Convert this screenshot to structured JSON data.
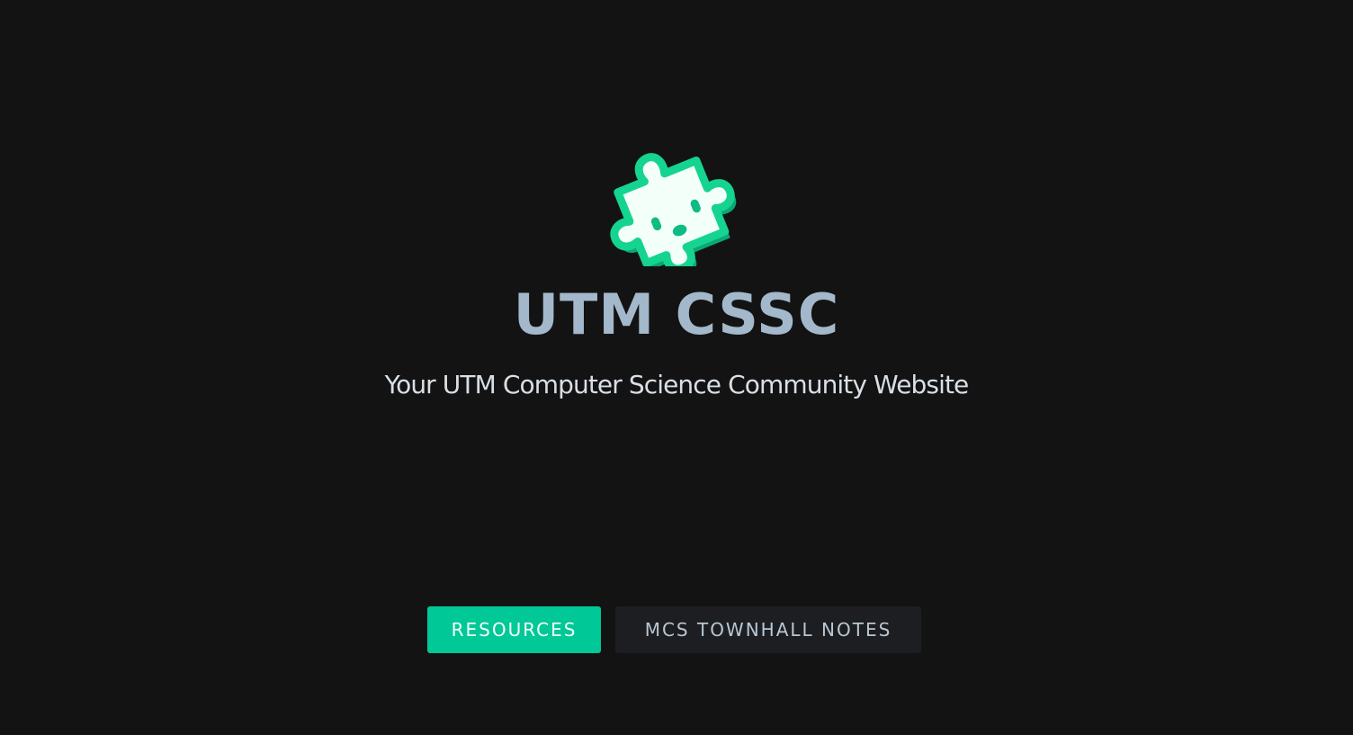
{
  "hero": {
    "logo_icon": "puzzle-piece-icon",
    "title": "UTM CSSC",
    "subtitle": "Your UTM Computer Science Community Website"
  },
  "actions": {
    "resources_label": "Resources",
    "townhall_label": "MCS Townhall Notes"
  },
  "colors": {
    "background": "#131313",
    "title": "#a3b8ca",
    "subtitle": "#d9dfe6",
    "accent": "#00c896",
    "secondary_button": "#1c1e21"
  }
}
